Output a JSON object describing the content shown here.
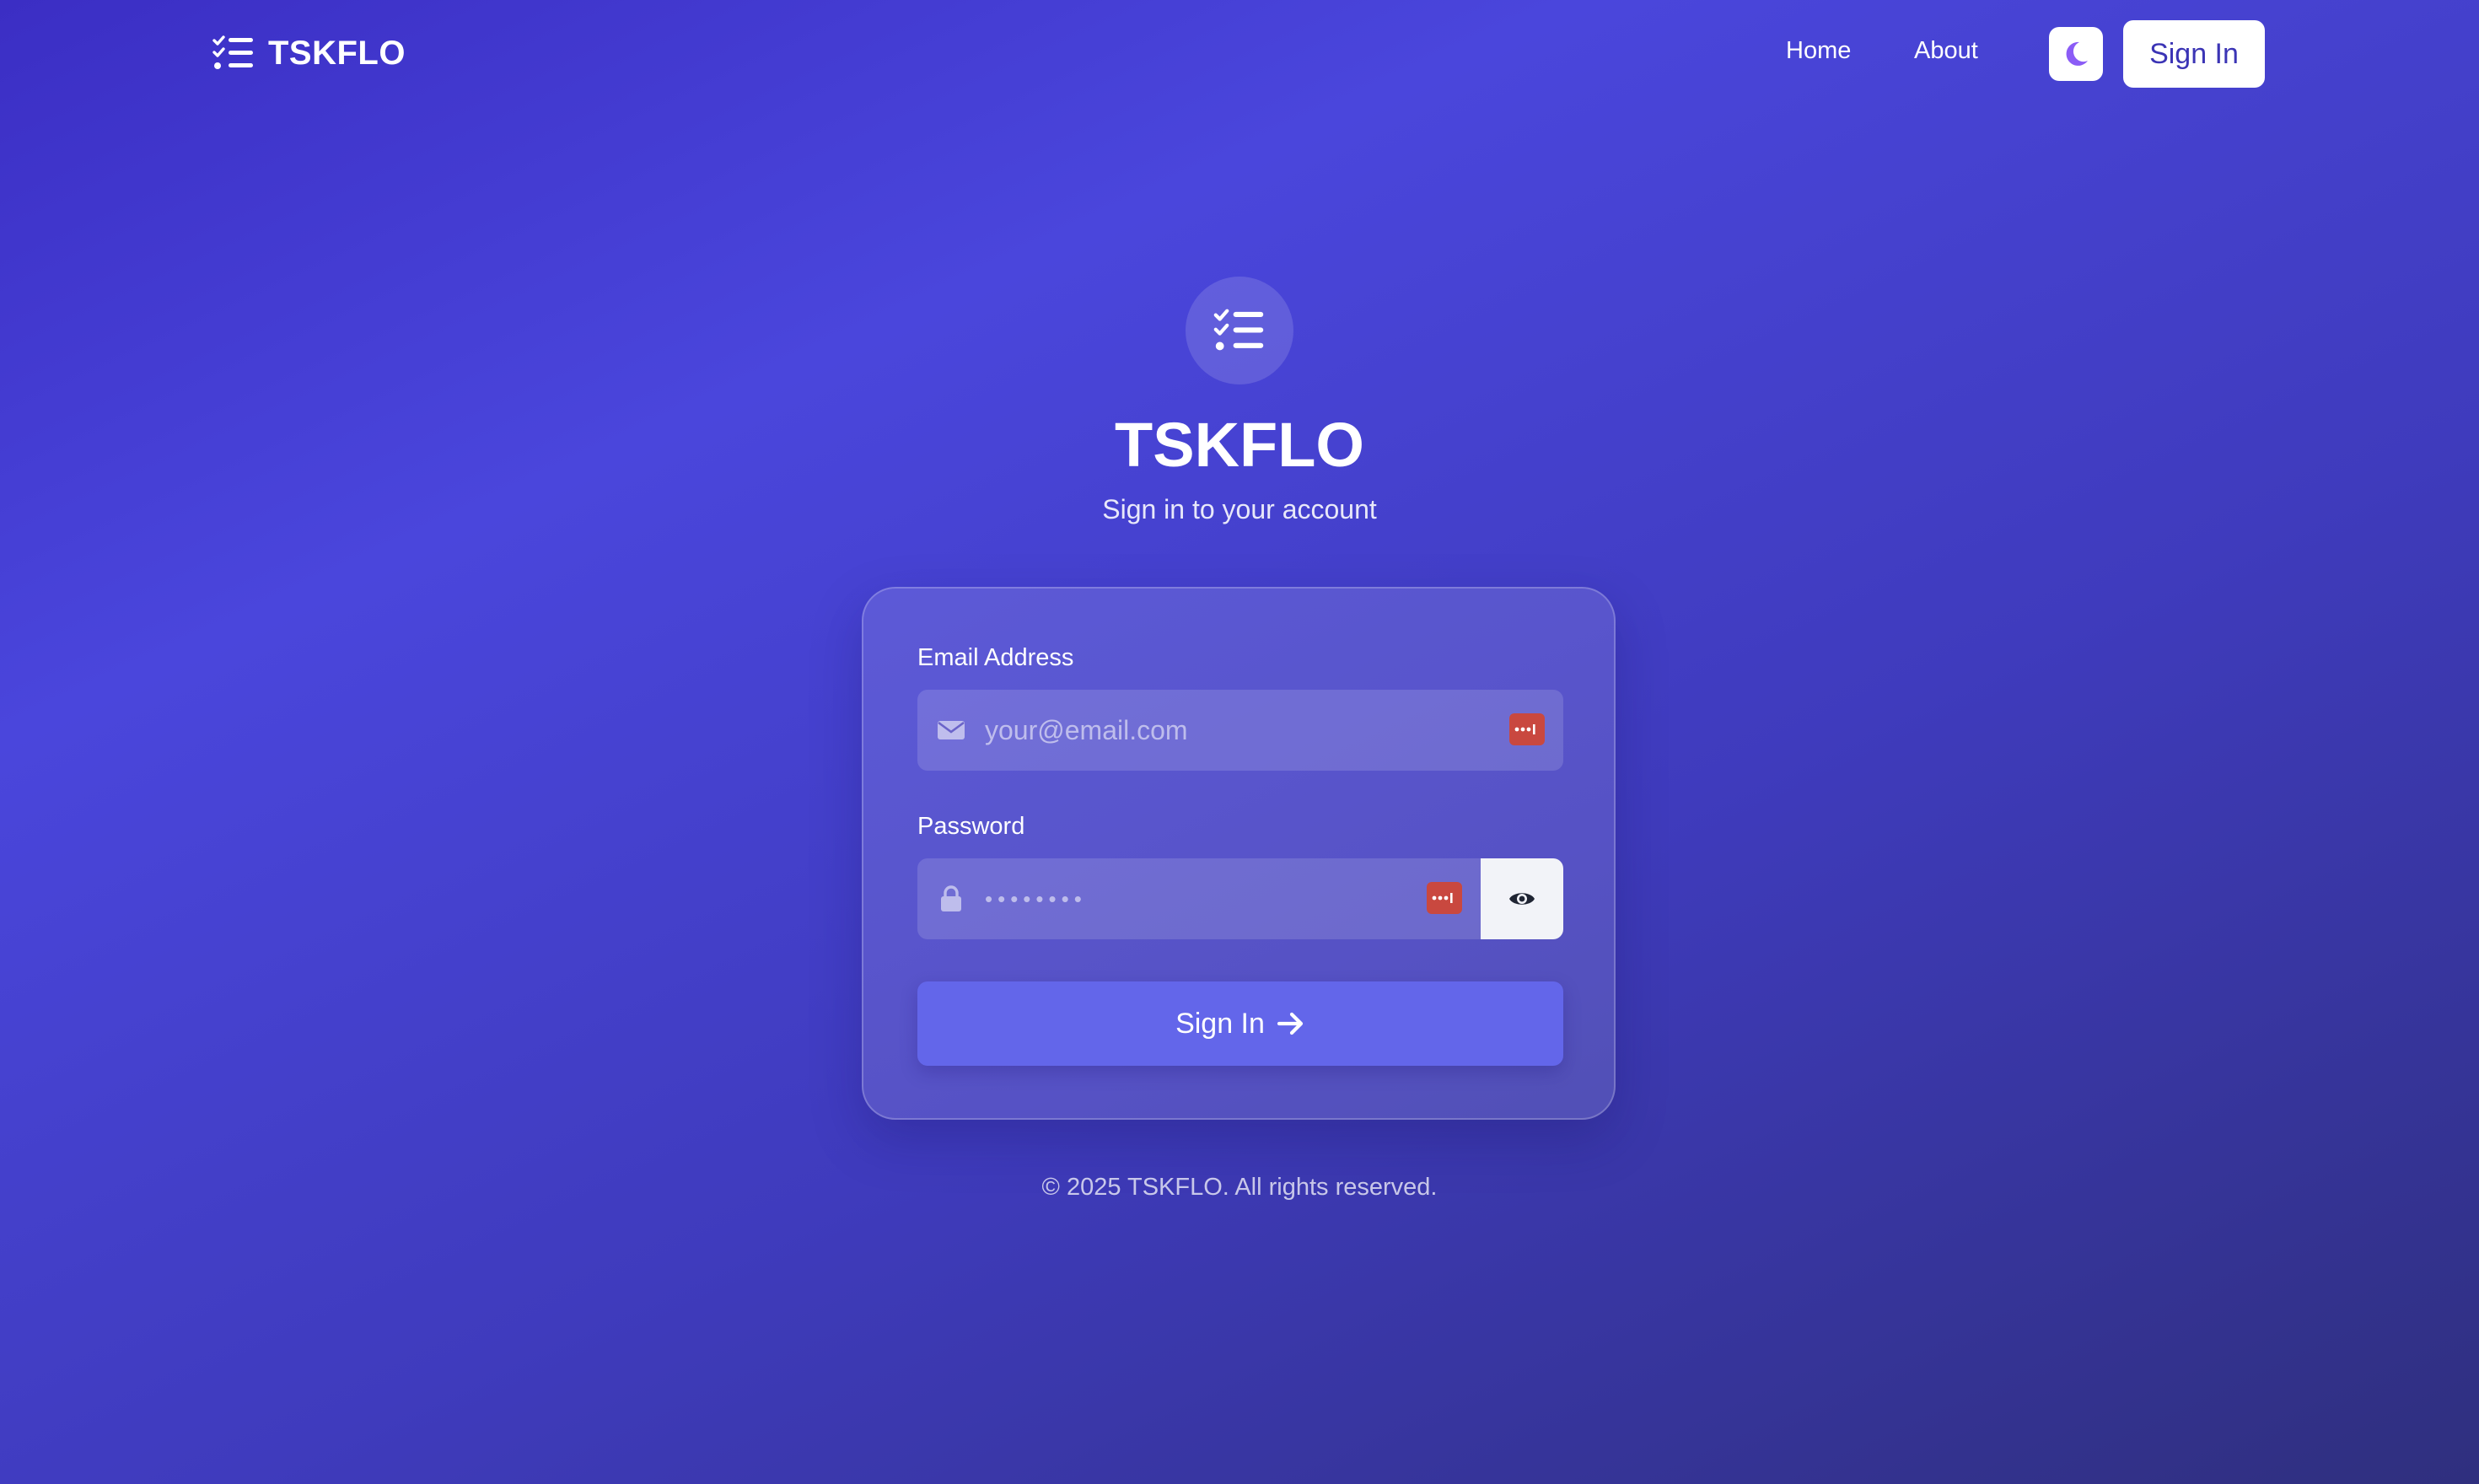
{
  "nav": {
    "brand": "TSKFLO",
    "brand_icon": "task-list-icon",
    "links": [
      {
        "label": "Home"
      },
      {
        "label": "About"
      }
    ],
    "theme_toggle_icon": "moon-icon",
    "sign_in_label": "Sign In"
  },
  "hero": {
    "icon": "task-list-icon",
    "title": "TSKFLO",
    "subtitle": "Sign in to your account"
  },
  "form": {
    "email": {
      "label": "Email Address",
      "placeholder": "your@email.com",
      "icon": "envelope-icon",
      "autofill_icon": "password-manager-icon"
    },
    "password": {
      "label": "Password",
      "placeholder": "••••••••",
      "icon": "lock-icon",
      "autofill_icon": "password-manager-icon",
      "toggle_icon": "eye-icon"
    },
    "submit_label": "Sign In",
    "submit_icon": "arrow-right-icon"
  },
  "footer": {
    "text": "© 2025 TSKFLO. All rights reserved."
  },
  "colors": {
    "background_start": "#3b2ec4",
    "background_end": "#2f2f7e",
    "accent_button": "#6366ea",
    "autofill_badge": "#c9483f",
    "moon": "#8b5cf6"
  }
}
